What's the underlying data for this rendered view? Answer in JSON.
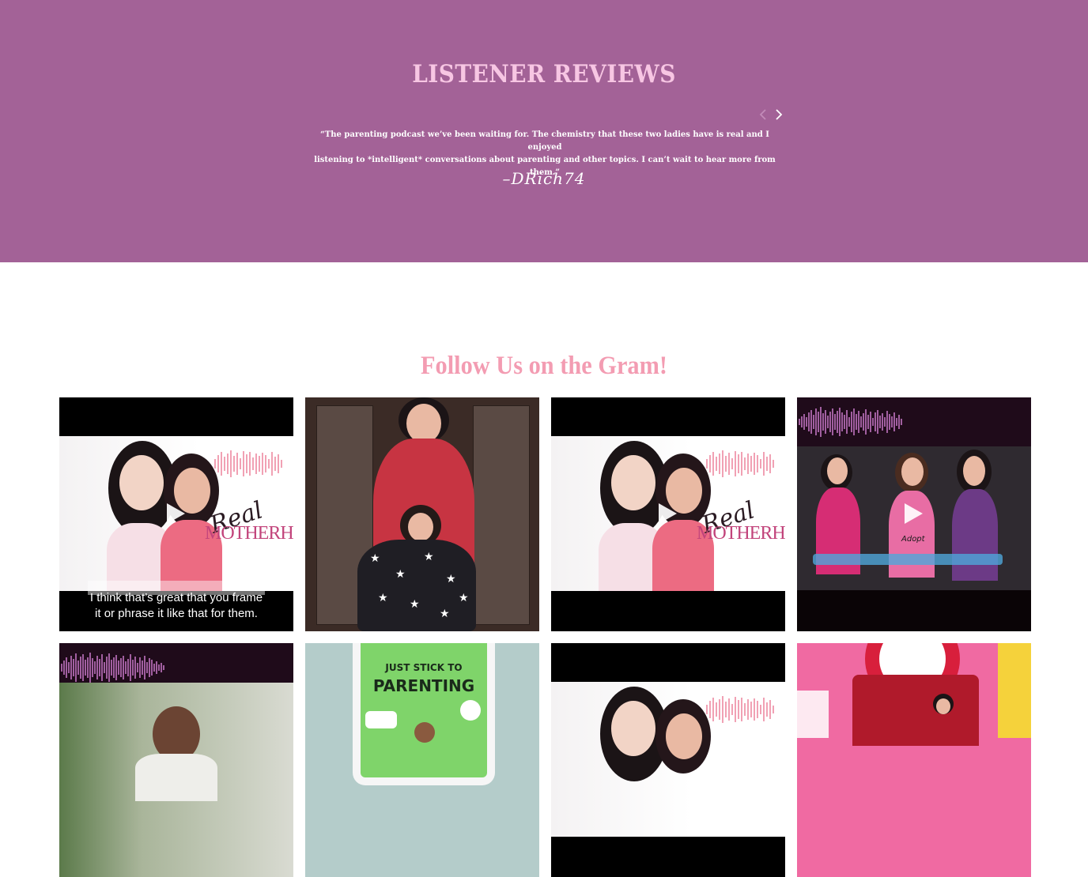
{
  "reviews": {
    "title": "LISTENER REVIEWS",
    "prev_icon": "chevron-left-icon",
    "next_icon": "chevron-right-icon",
    "quote_line1": "“The parenting podcast we’ve been waiting for. The chemistry that these two ladies have is real and I enjoyed",
    "quote_line2": "listening to *intelligent* conversations about parenting and other topics. I can’t wait to hear more from them.”",
    "author": "–DRich74",
    "colors": {
      "background": "#a36297",
      "title": "#f7c6e3"
    }
  },
  "instagram": {
    "title": "Follow Us on the Gram!",
    "title_color": "#f39cb2",
    "posts": [
      {
        "brand_script": "Real",
        "brand_name": "MOTHERHOOD",
        "caption_line1": "I think that’s great that you frame",
        "caption_line2": "it or phrase it like that for them."
      },
      {},
      {
        "brand_script": "Real",
        "brand_name": "MOTHERHOOD"
      },
      {
        "shirt_text": "Adopt"
      },
      {},
      {
        "book_title_1": "JUST STICK TO",
        "book_title_2": "PARENTING"
      },
      {},
      {}
    ]
  }
}
